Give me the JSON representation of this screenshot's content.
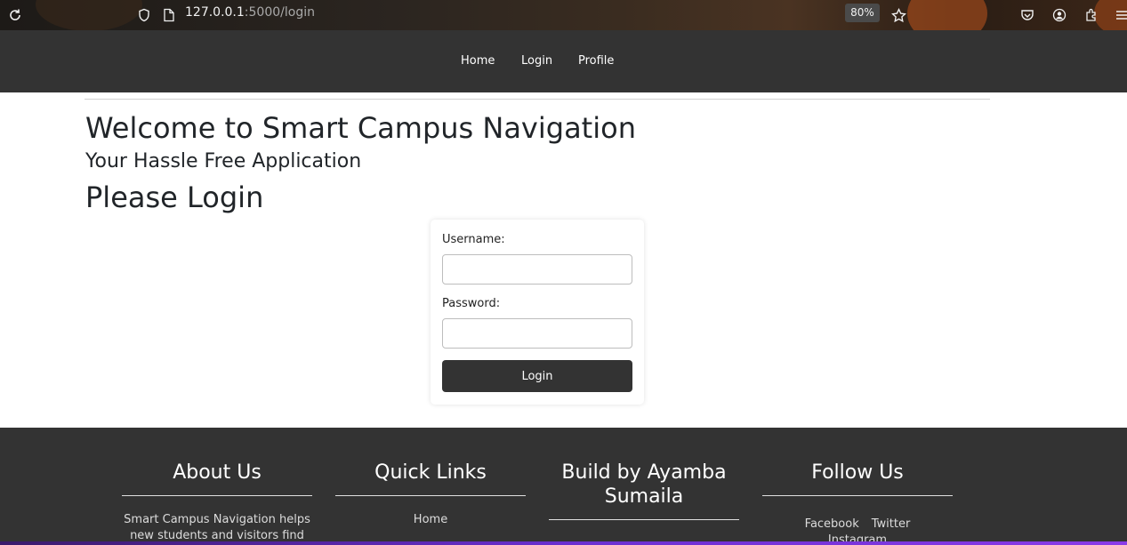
{
  "browser": {
    "url_host": "127.0.0.1",
    "url_rest": ":5000/login",
    "zoom": "80%",
    "icons": [
      "reload-icon",
      "shield-icon",
      "page-icon",
      "star-icon",
      "pocket-icon",
      "account-icon",
      "extensions-icon",
      "menu-icon"
    ]
  },
  "nav": {
    "items": [
      {
        "label": "Home"
      },
      {
        "label": "Login"
      },
      {
        "label": "Profile"
      }
    ]
  },
  "main": {
    "welcome": "Welcome to Smart Campus Navigation",
    "subtitle": "Your Hassle Free Application",
    "prompt": "Please Login"
  },
  "form": {
    "username_label": "Username:",
    "username_value": "",
    "password_label": "Password:",
    "password_value": "",
    "submit_label": "Login"
  },
  "footer": {
    "about": {
      "title": "About Us",
      "text": "Smart Campus Navigation helps new students and visitors find"
    },
    "quick_links": {
      "title": "Quick Links",
      "items": [
        "Home"
      ]
    },
    "build": {
      "title": "Build by Ayamba Sumaila"
    },
    "follow": {
      "title": "Follow Us",
      "items": [
        "Facebook",
        "Twitter",
        "Instagram"
      ]
    }
  },
  "colors": {
    "navbar": "#333333",
    "footer": "#333333",
    "button": "#333333",
    "text": "#212529"
  }
}
